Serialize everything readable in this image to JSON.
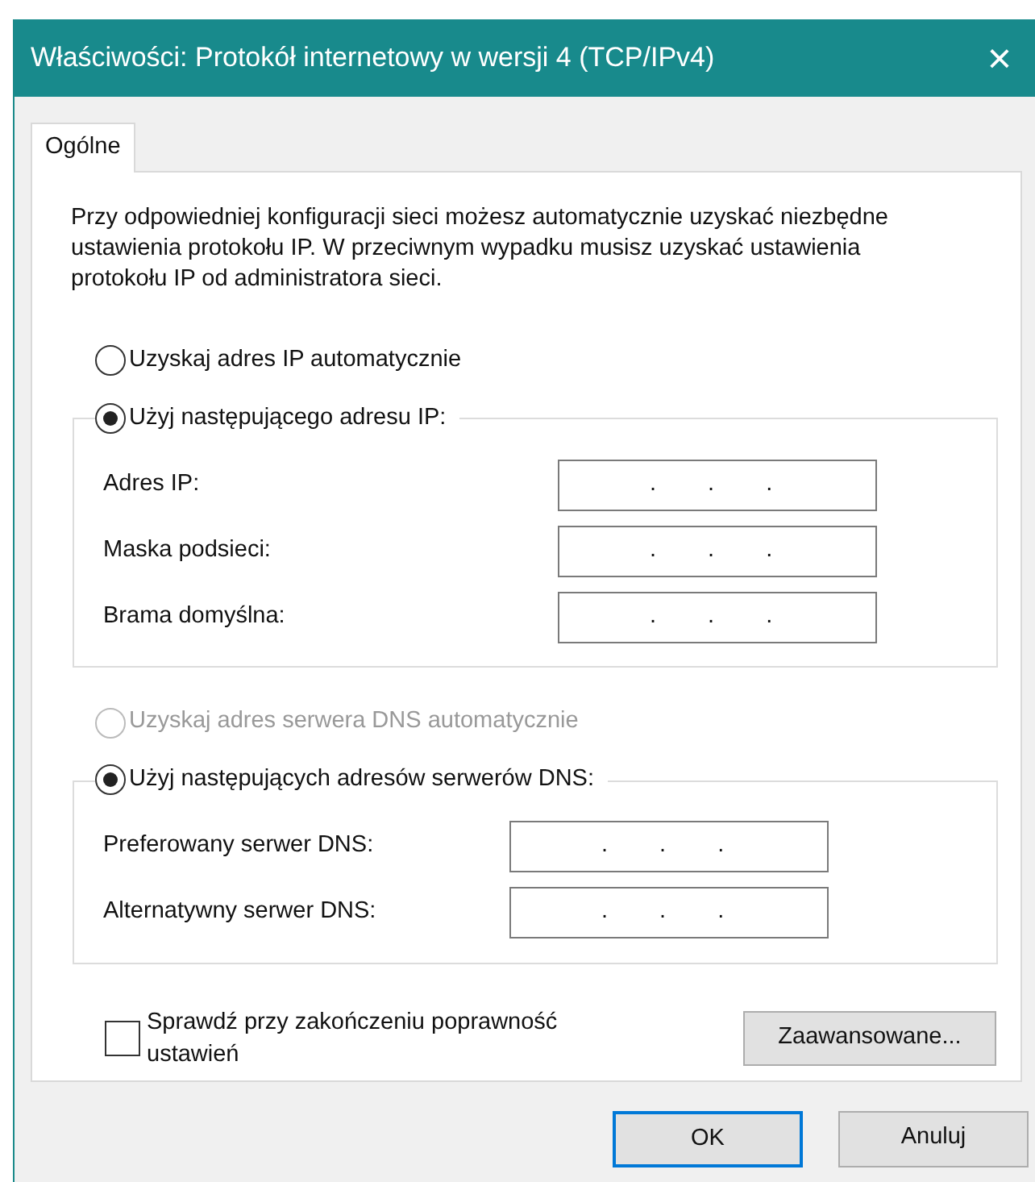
{
  "window": {
    "title": "Właściwości: Protokół internetowy w wersji 4 (TCP/IPv4)",
    "close": "×"
  },
  "tabs": [
    {
      "label": "Ogólne",
      "selected": true
    }
  ],
  "intro": "Przy odpowiedniej konfiguracji sieci możesz automatycznie uzyskać niezbędne ustawienia protokołu IP. W przeciwnym wypadku musisz uzyskać ustawienia protokołu IP od administratora sieci.",
  "ip_section": {
    "auto_option": {
      "label": "Uzyskaj adres IP automatycznie",
      "selected": false,
      "disabled": false
    },
    "manual_option": {
      "label": "Użyj następującego adresu IP:",
      "selected": true,
      "disabled": false
    },
    "fields": [
      {
        "label": "Adres IP:",
        "separator": "."
      },
      {
        "label": "Maska podsieci:",
        "separator": "."
      },
      {
        "label": "Brama domyślna:",
        "separator": "."
      }
    ]
  },
  "dns_section": {
    "auto_option": {
      "label": "Uzyskaj adres serwera DNS automatycznie",
      "selected": false,
      "disabled": true
    },
    "manual_option": {
      "label": "Użyj następujących adresów serwerów DNS:",
      "selected": true,
      "disabled": false
    },
    "fields": [
      {
        "label": "Preferowany serwer DNS:",
        "separator": "."
      },
      {
        "label": "Alternatywny serwer DNS:",
        "separator": "."
      }
    ]
  },
  "validate_checkbox": {
    "label": "Sprawdź przy zakończeniu poprawność ustawień",
    "checked": false
  },
  "advanced_button": "Zaawansowane...",
  "buttons": [
    {
      "label": "OK",
      "default": true
    },
    {
      "label": "Anuluj",
      "default": false
    }
  ]
}
